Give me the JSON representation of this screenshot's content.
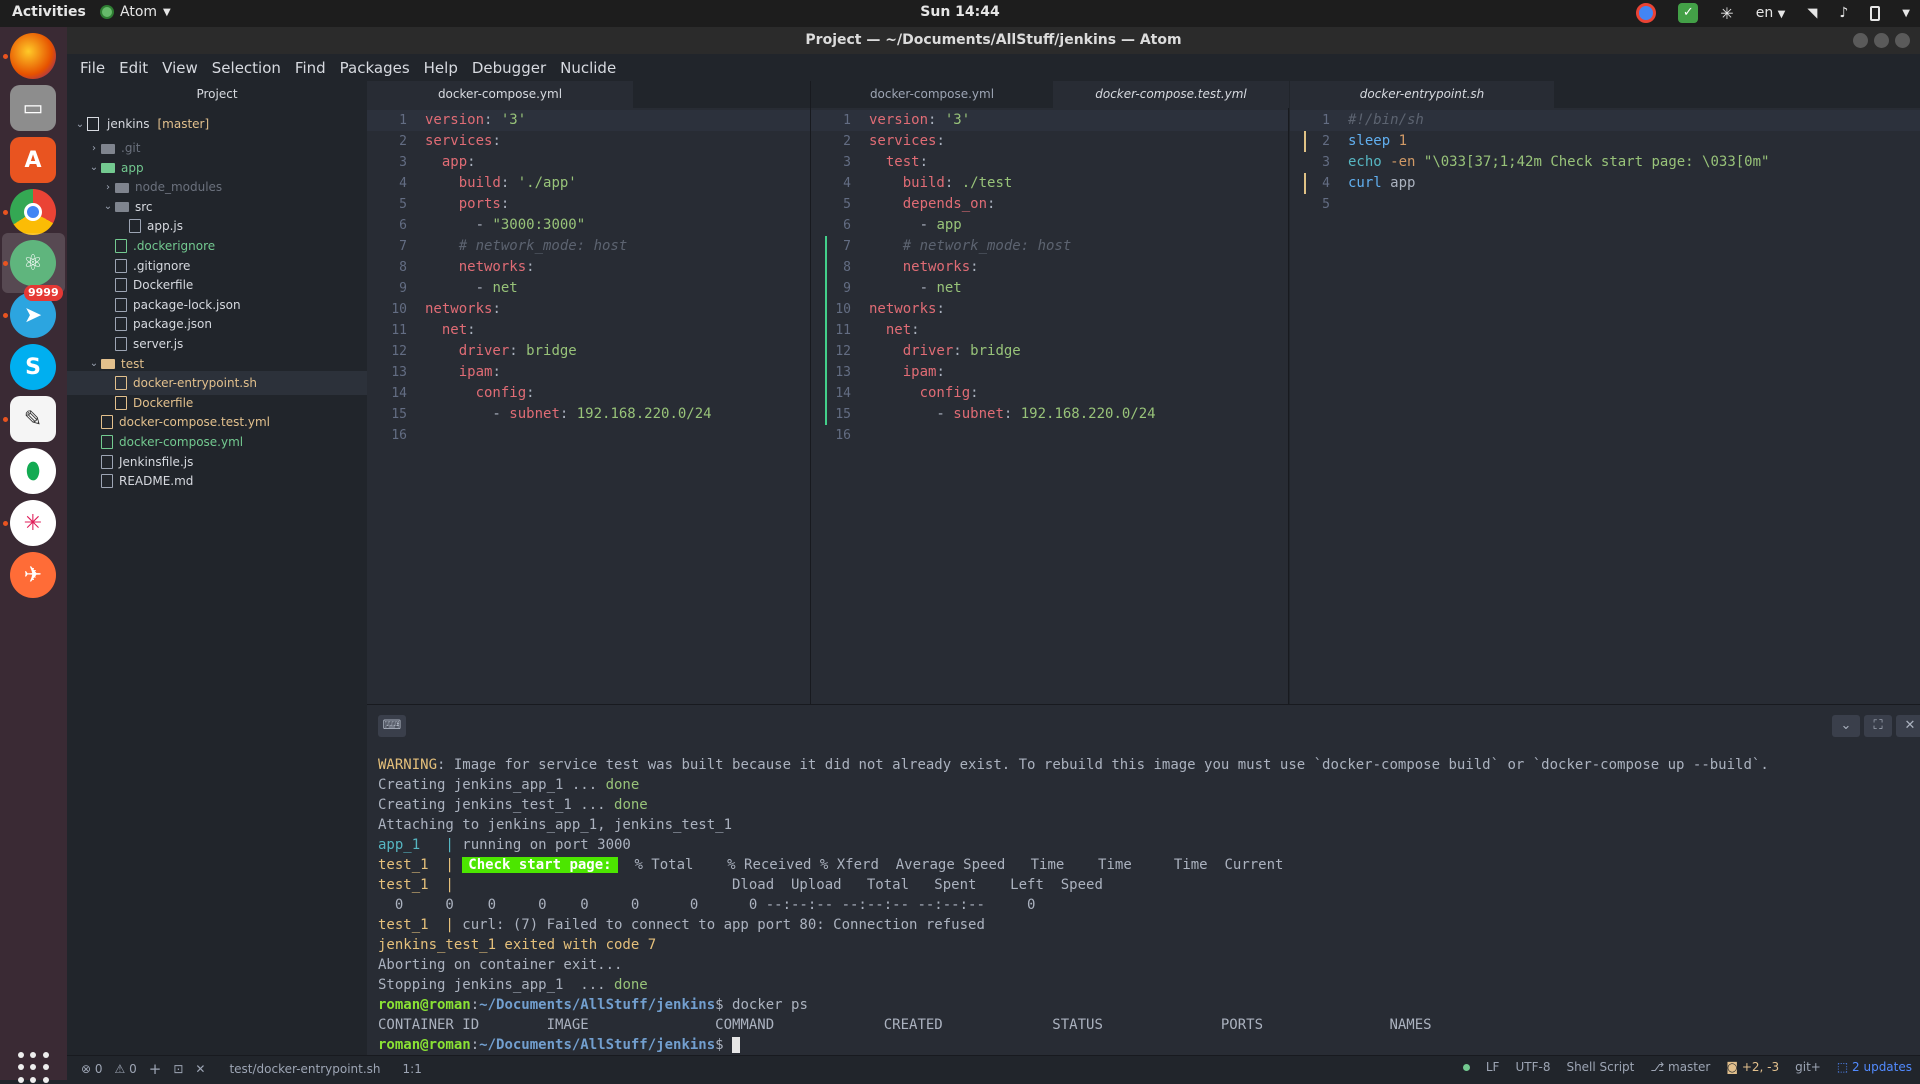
{
  "topbar": {
    "activities": "Activities",
    "app_name": "Atom",
    "clock": "Sun 14:44",
    "lang": "en"
  },
  "window": {
    "title": "Project — ~/Documents/AllStuff/jenkins — Atom"
  },
  "dock": {
    "telegram_badge": "9999"
  },
  "menu": [
    "File",
    "Edit",
    "View",
    "Selection",
    "Find",
    "Packages",
    "Help",
    "Debugger",
    "Nuclide"
  ],
  "tree": {
    "title": "Project",
    "root": "jenkins",
    "branch": "[master]",
    "items": [
      {
        "label": ".git",
        "type": "dir",
        "depth": 1,
        "color": "muted",
        "open": false
      },
      {
        "label": "app",
        "type": "dir",
        "depth": 1,
        "color": "green",
        "open": true
      },
      {
        "label": "node_modules",
        "type": "dir",
        "depth": 2,
        "color": "muted",
        "open": false
      },
      {
        "label": "src",
        "type": "dir",
        "depth": 2,
        "color": "main",
        "open": true
      },
      {
        "label": "app.js",
        "type": "file",
        "depth": 3,
        "color": "main"
      },
      {
        "label": ".dockerignore",
        "type": "file",
        "depth": 2,
        "color": "green"
      },
      {
        "label": ".gitignore",
        "type": "file",
        "depth": 2,
        "color": "main"
      },
      {
        "label": "Dockerfile",
        "type": "file",
        "depth": 2,
        "color": "main"
      },
      {
        "label": "package-lock.json",
        "type": "file",
        "depth": 2,
        "color": "main"
      },
      {
        "label": "package.json",
        "type": "file",
        "depth": 2,
        "color": "main"
      },
      {
        "label": "server.js",
        "type": "file",
        "depth": 2,
        "color": "main"
      },
      {
        "label": "test",
        "type": "dir",
        "depth": 1,
        "color": "yellow",
        "open": true
      },
      {
        "label": "docker-entrypoint.sh",
        "type": "file",
        "depth": 2,
        "color": "yellow",
        "selected": true
      },
      {
        "label": "Dockerfile",
        "type": "file",
        "depth": 2,
        "color": "yellow"
      },
      {
        "label": "docker-compose.test.yml",
        "type": "file",
        "depth": 1,
        "color": "yellow"
      },
      {
        "label": "docker-compose.yml",
        "type": "file",
        "depth": 1,
        "color": "green"
      },
      {
        "label": "Jenkinsfile.js",
        "type": "file",
        "depth": 1,
        "color": "main"
      },
      {
        "label": "README.md",
        "type": "file",
        "depth": 1,
        "color": "main"
      }
    ]
  },
  "panes": [
    {
      "tabs": [
        {
          "label": "docker-compose.yml",
          "active": true,
          "italic": false
        }
      ],
      "lines": [
        [
          [
            "k",
            "version"
          ],
          [
            "p",
            ": "
          ],
          [
            "s",
            "'3'"
          ]
        ],
        [
          [
            "k",
            "services"
          ],
          [
            "p",
            ":"
          ]
        ],
        [
          [
            "p",
            "  "
          ],
          [
            "k",
            "app"
          ],
          [
            "p",
            ":"
          ]
        ],
        [
          [
            "p",
            "    "
          ],
          [
            "k",
            "build"
          ],
          [
            "p",
            ": "
          ],
          [
            "s",
            "'./app'"
          ]
        ],
        [
          [
            "p",
            "    "
          ],
          [
            "k",
            "ports"
          ],
          [
            "p",
            ":"
          ]
        ],
        [
          [
            "p",
            "      - "
          ],
          [
            "s",
            "\"3000:3000\""
          ]
        ],
        [
          [
            "c",
            "    # network_mode: host"
          ]
        ],
        [
          [
            "p",
            "    "
          ],
          [
            "k",
            "networks"
          ],
          [
            "p",
            ":"
          ]
        ],
        [
          [
            "p",
            "      - "
          ],
          [
            "s",
            "net"
          ]
        ],
        [
          [
            "k",
            "networks"
          ],
          [
            "p",
            ":"
          ]
        ],
        [
          [
            "p",
            "  "
          ],
          [
            "k",
            "net"
          ],
          [
            "p",
            ":"
          ]
        ],
        [
          [
            "p",
            "    "
          ],
          [
            "k",
            "driver"
          ],
          [
            "p",
            ": "
          ],
          [
            "s",
            "bridge"
          ]
        ],
        [
          [
            "p",
            "    "
          ],
          [
            "k",
            "ipam"
          ],
          [
            "p",
            ":"
          ]
        ],
        [
          [
            "p",
            "      "
          ],
          [
            "k",
            "config"
          ],
          [
            "p",
            ":"
          ]
        ],
        [
          [
            "p",
            "        - "
          ],
          [
            "k",
            "subnet"
          ],
          [
            "p",
            ": "
          ],
          [
            "s",
            "192.168.220.0/24"
          ]
        ],
        []
      ],
      "numbers": [
        "1",
        "2",
        "3",
        "4",
        "5",
        "6",
        "7",
        "8",
        "9",
        "10",
        "11",
        "12",
        "13",
        "14",
        "15",
        "16"
      ]
    },
    {
      "tabs": [
        {
          "label": "docker-compose.yml",
          "active": false,
          "italic": false
        },
        {
          "label": "docker-compose.test.yml",
          "active": true,
          "italic": true
        }
      ],
      "lines": [
        [
          [
            "k",
            "version"
          ],
          [
            "p",
            ": "
          ],
          [
            "s",
            "'3'"
          ]
        ],
        [
          [
            "k",
            "services"
          ],
          [
            "p",
            ":"
          ]
        ],
        [
          [
            "p",
            "  "
          ],
          [
            "k",
            "test"
          ],
          [
            "p",
            ":"
          ]
        ],
        [
          [
            "p",
            "    "
          ],
          [
            "k",
            "build"
          ],
          [
            "p",
            ": "
          ],
          [
            "s",
            "./test"
          ]
        ],
        [
          [
            "p",
            "    "
          ],
          [
            "k",
            "depends_on"
          ],
          [
            "p",
            ":"
          ]
        ],
        [
          [
            "p",
            "      - "
          ],
          [
            "s",
            "app"
          ]
        ],
        [
          [
            "c",
            "    # network_mode: host"
          ]
        ],
        [
          [
            "p",
            "    "
          ],
          [
            "k",
            "networks"
          ],
          [
            "p",
            ":"
          ]
        ],
        [
          [
            "p",
            "      - "
          ],
          [
            "s",
            "net"
          ]
        ],
        [
          [
            "k",
            "networks"
          ],
          [
            "p",
            ":"
          ]
        ],
        [
          [
            "p",
            "  "
          ],
          [
            "k",
            "net"
          ],
          [
            "p",
            ":"
          ]
        ],
        [
          [
            "p",
            "    "
          ],
          [
            "k",
            "driver"
          ],
          [
            "p",
            ": "
          ],
          [
            "s",
            "bridge"
          ]
        ],
        [
          [
            "p",
            "    "
          ],
          [
            "k",
            "ipam"
          ],
          [
            "p",
            ":"
          ]
        ],
        [
          [
            "p",
            "      "
          ],
          [
            "k",
            "config"
          ],
          [
            "p",
            ":"
          ]
        ],
        [
          [
            "p",
            "        - "
          ],
          [
            "k",
            "subnet"
          ],
          [
            "p",
            ": "
          ],
          [
            "s",
            "192.168.220.0/24"
          ]
        ],
        []
      ],
      "numbers": [
        "1",
        "2",
        "3",
        "4",
        "5",
        "6",
        "7",
        "8",
        "9",
        "10",
        "11",
        "12",
        "13",
        "14",
        "15",
        "16"
      ]
    },
    {
      "tabs": [
        {
          "label": "docker-entrypoint.sh",
          "active": true,
          "italic": true
        }
      ],
      "lines": [
        [
          [
            "c",
            "#!/bin/sh"
          ]
        ],
        [
          [
            "f",
            "sleep"
          ],
          [
            "p",
            " "
          ],
          [
            "o",
            "1"
          ]
        ],
        [
          [
            "cy",
            "echo"
          ],
          [
            "p",
            " "
          ],
          [
            "o",
            "-en"
          ],
          [
            "p",
            " "
          ],
          [
            "s",
            "\"\\033[37;1;42m Check start page: \\033[0m\""
          ]
        ],
        [
          [
            "f",
            "curl"
          ],
          [
            "p",
            " app"
          ]
        ],
        []
      ],
      "numbers": [
        "1",
        "2",
        "3",
        "4",
        "5"
      ]
    }
  ],
  "terminal": {
    "lines": [
      [
        [
          "tyellow",
          "WARNING"
        ],
        [
          "",
          "Image for service test was built because it did not already exist. To rebuild this image you must use `docker-compose build` or `docker-compose up --build`."
        ]
      ],
      [
        [
          "",
          "Creating jenkins_app_1 ... "
        ],
        [
          "tgreen",
          "done"
        ]
      ],
      [
        [
          "",
          "Creating jenkins_test_1 ... "
        ],
        [
          "tgreen",
          "done"
        ]
      ],
      [
        [
          "",
          "Attaching to jenkins_app_1, jenkins_test_1"
        ]
      ],
      [
        [
          "tcyan",
          "app_1   |"
        ],
        [
          "",
          " running on port 3000"
        ]
      ],
      [
        [
          "tyellow",
          "test_1  |"
        ],
        [
          "",
          " "
        ],
        [
          "tbadge",
          "Check start page:"
        ],
        [
          "",
          "  % Total    % Received % Xferd  Average Speed   Time    Time     Time  Current"
        ]
      ],
      [
        [
          "tyellow",
          "test_1  |"
        ],
        [
          "",
          "                                 Dload  Upload   Total   Spent    Left  Speed"
        ]
      ],
      [
        [
          "",
          "  0     0    0     0    0     0      0      0 --:--:-- --:--:-- --:--:--     0"
        ]
      ],
      [
        [
          "tyellow",
          "test_1  |"
        ],
        [
          "",
          " curl: (7) Failed to connect to app port 80: Connection refused"
        ]
      ],
      [
        [
          "tyellow",
          "jenkins_test_1 exited with code 7"
        ]
      ],
      [
        [
          "",
          "Aborting on container exit..."
        ]
      ],
      [
        [
          "",
          "Stopping jenkins_app_1  ... "
        ],
        [
          "tgreen",
          "done"
        ]
      ],
      [
        [
          "tpromptu",
          "roman@roman"
        ],
        [
          "",
          ":"
        ],
        [
          "tpromptp",
          "~/Documents/AllStuff/jenkins"
        ],
        [
          "",
          "$ docker ps"
        ]
      ],
      [
        [
          "",
          "CONTAINER ID        IMAGE               COMMAND             CREATED             STATUS              PORTS               NAMES"
        ]
      ],
      [
        [
          "tpromptu",
          "roman@roman"
        ],
        [
          "",
          ":"
        ],
        [
          "tpromptp",
          "~/Documents/AllStuff/jenkins"
        ],
        [
          "",
          "$ "
        ],
        [
          "cursor",
          ""
        ]
      ]
    ]
  },
  "status": {
    "errors": "0",
    "warnings": "0",
    "path": "test/docker-entrypoint.sh",
    "cursor": "1:1",
    "line_ending": "LF",
    "encoding": "UTF-8",
    "grammar": "Shell Script",
    "branch": "master",
    "diff": "+2, -3",
    "git": "git+",
    "updates": "2 updates"
  }
}
